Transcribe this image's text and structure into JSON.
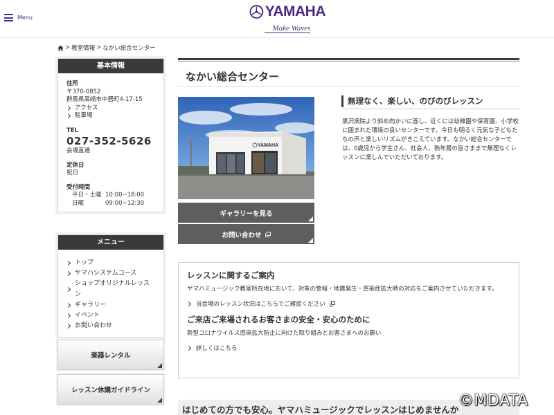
{
  "header": {
    "menu_label": "Menu",
    "logo_text": "YAMAHA",
    "logo_tagline": "Make Waves"
  },
  "breadcrumb": {
    "items": [
      "教室情報",
      "なかい総合センター"
    ]
  },
  "info": {
    "heading": "基本情報",
    "address_label": "住所",
    "postal": "〒370-0852",
    "address": "群馬県高崎市中居町4-17-15",
    "access_link": "アクセス",
    "parking_link": "駐車場",
    "tel_label": "TEL",
    "tel": "027-352-5626",
    "tel_note": "会場直通",
    "closed_label": "定休日",
    "closed_value": "祝日",
    "hours_label": "受付時間",
    "hours": [
      {
        "day": "平日・土曜",
        "time": "10:00~18:00"
      },
      {
        "day": "日曜",
        "time": "09:00~12:30"
      }
    ]
  },
  "side_menu": {
    "heading": "メニュー",
    "items": [
      "トップ",
      "ヤマハシステムコース",
      "ショップオリジナルレッスン",
      "ギャラリー",
      "イベント",
      "お問い合わせ"
    ]
  },
  "side_buttons": {
    "rental": "楽器レンタル",
    "guideline": "レッスン休講ガイドライン"
  },
  "main": {
    "title": "なかい総合センター",
    "gallery_button": "ギャラリーを見る",
    "contact_button": "お問い合わせ",
    "subheading": "無理なく、楽しい、のびのびレッスン",
    "description": "黒沢病院より斜め向かいに面し、近くには幼稚園や保育園、小学校に囲まれた環境の良いセンターです。今日も明るく元気な子どもたちの声と楽しいリズムがきこえています。なかい総合センターでは、0歳児から学生さん、社会人、熟年層の皆さままで無理なくレッスンに楽しんでいただいております。"
  },
  "notice": {
    "heading1": "レッスンに関するご案内",
    "text1": "ヤマハミュージック教室所在地において、対象の警報・地震発生・感染症拡大時の対応をご案内させていただきます。",
    "link1": "当会場のレッスン状況はこちらでご確認ください",
    "heading2": "ご来店ご来場されるお客さまの安全・安心のために",
    "text2": "新型コロナウイルス感染拡大防止に向けた取り組みとお客さまへのお願い",
    "link2": "詳しくはこちら"
  },
  "bottom": {
    "banner_text": "はじめての方でも安心。ヤマハミュージックでレッスンはじめませんか"
  },
  "watermark": "©MDATA",
  "colors": {
    "brand_purple": "#4b2a85",
    "dark_header": "#3a3a3a",
    "button_gray": "#5e5e5e"
  }
}
